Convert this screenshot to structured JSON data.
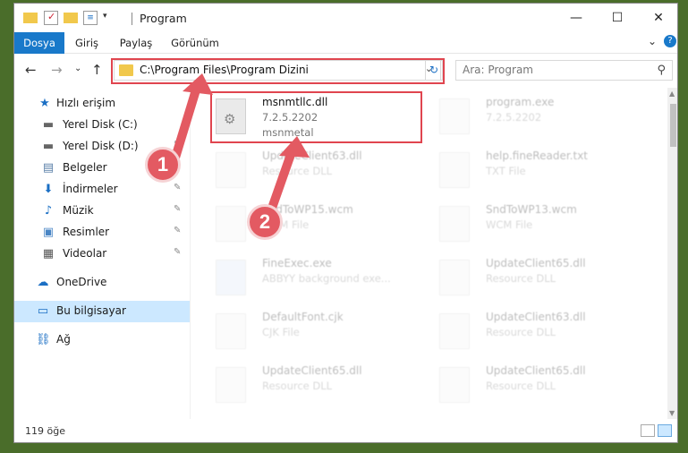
{
  "window": {
    "title": "Program",
    "minimize_glyph": "—",
    "maximize_glyph": "☐",
    "close_glyph": "✕"
  },
  "ribbon": {
    "tabs": [
      "Dosya",
      "Giriş",
      "Paylaş",
      "Görünüm"
    ],
    "active_tab": "Dosya",
    "accent": "#1979ca",
    "expand_glyph": "⌄",
    "help_glyph": "?"
  },
  "nav": {
    "back_glyph": "←",
    "forward_glyph": "→",
    "recent_glyph": "⌄",
    "up_glyph": "↑",
    "address": "C:\\Program Files\\Program Dizini",
    "address_dropdown_glyph": "⌄",
    "refresh_glyph": "↻",
    "search_placeholder": "Ara: Program",
    "search_glyph": "⚲"
  },
  "sidebar": {
    "items": [
      {
        "label": "Hızlı erişim",
        "icon": "star-icon",
        "glyph": "★",
        "pinned": false
      },
      {
        "label": "Yerel Disk (C:)",
        "icon": "disk-icon",
        "glyph": "▬",
        "pinned": false
      },
      {
        "label": "Yerel Disk (D:)",
        "icon": "disk-icon",
        "glyph": "▬",
        "pinned": true
      },
      {
        "label": "Belgeler",
        "icon": "documents-icon",
        "glyph": "▤",
        "pinned": true
      },
      {
        "label": "İndirmeler",
        "icon": "download-icon",
        "glyph": "⬇",
        "pinned": true
      },
      {
        "label": "Müzik",
        "icon": "music-icon",
        "glyph": "♪",
        "pinned": true
      },
      {
        "label": "Resimler",
        "icon": "pictures-icon",
        "glyph": "▣",
        "pinned": true
      },
      {
        "label": "Videolar",
        "icon": "videos-icon",
        "glyph": "▦",
        "pinned": true
      },
      {
        "label": "OneDrive",
        "icon": "cloud-icon",
        "glyph": "☁",
        "pinned": false
      },
      {
        "label": "Bu bilgisayar",
        "icon": "computer-icon",
        "glyph": "▭",
        "pinned": false
      },
      {
        "label": "Ağ",
        "icon": "network-icon",
        "glyph": "⛓",
        "pinned": false
      }
    ],
    "pin_glyph": "📌"
  },
  "files": [
    {
      "name": "msnmtllc.dll",
      "line1": "7.2.5.2202",
      "line2": "msnmetal"
    },
    {
      "name": "program.exe",
      "line1": "7.2.5.2202",
      "line2": ""
    },
    {
      "name": "UpdateClient63.dll",
      "line1": "Resource DLL",
      "line2": ""
    },
    {
      "name": "help.fineReader.txt",
      "line1": "TXT File",
      "line2": ""
    },
    {
      "name": "SndToWP15.wcm",
      "line1": "WCM File",
      "line2": ""
    },
    {
      "name": "SndToWP13.wcm",
      "line1": "WCM File",
      "line2": ""
    },
    {
      "name": "FineExec.exe",
      "line1": "ABBYY background exe...",
      "line2": ""
    },
    {
      "name": "UpdateClient65.dll",
      "line1": "Resource DLL",
      "line2": ""
    },
    {
      "name": "DefaultFont.cjk",
      "line1": "CJK File",
      "line2": ""
    },
    {
      "name": "UpdateClient63.dll",
      "line1": "Resource DLL",
      "line2": ""
    },
    {
      "name": "UpdateClient65.dll",
      "line1": "Resource DLL",
      "line2": ""
    },
    {
      "name": "UpdateClient65.dll",
      "line1": "Resource DLL",
      "line2": ""
    }
  ],
  "status": {
    "count": "119 öğe"
  },
  "annotations": {
    "badge1": "1",
    "badge2": "2",
    "color": "#e0454f"
  }
}
